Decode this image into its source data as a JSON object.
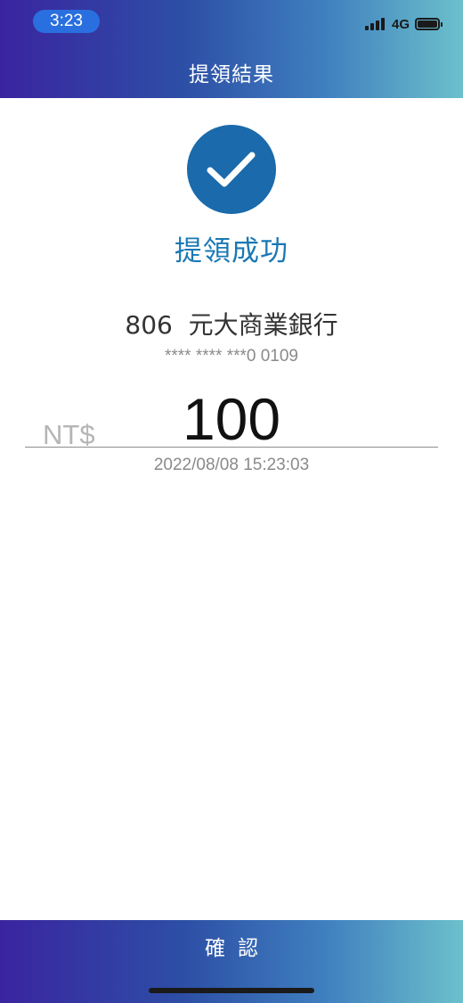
{
  "status_bar": {
    "time": "3:23",
    "network": "4G",
    "signal_icon": "signal-bars-icon",
    "battery_icon": "battery-full-icon"
  },
  "nav": {
    "title": "提領結果"
  },
  "result": {
    "icon": "checkmark-circle-icon",
    "title": "提領成功"
  },
  "bank": {
    "name": "806  元大商業銀行",
    "account_masked": "**** **** ***0 0109"
  },
  "amount": {
    "currency": "NT$",
    "value": "100",
    "timestamp": "2022/08/08 15:23:03"
  },
  "footer": {
    "confirm_label": "確認"
  },
  "colors": {
    "accent": "#1b6aab",
    "title_blue": "#1a78b4",
    "gradient_start": "#3a24a0",
    "gradient_end": "#6cc0cc"
  }
}
